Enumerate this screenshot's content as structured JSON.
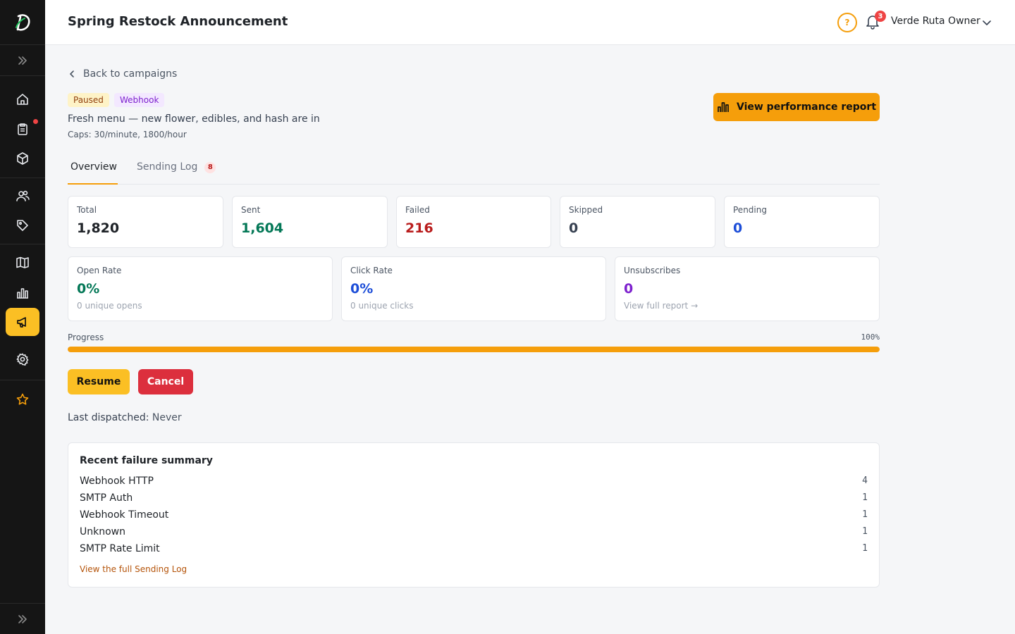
{
  "header": {
    "title": "Spring Restock Announcement",
    "help_icon": "?",
    "notification_count": "3",
    "user_name": "Verde Ruta Owner"
  },
  "sidebar": {
    "items": [
      {
        "name": "home",
        "icon": "home-icon"
      },
      {
        "name": "orders",
        "icon": "clipboard-icon",
        "has_dot": true
      },
      {
        "name": "products",
        "icon": "box-icon"
      },
      {
        "name": "customers",
        "icon": "users-icon"
      },
      {
        "name": "promotions",
        "icon": "tag-icon"
      },
      {
        "name": "menus",
        "icon": "book-icon"
      },
      {
        "name": "analytics",
        "icon": "bar-chart-icon"
      },
      {
        "name": "campaigns",
        "icon": "megaphone-icon",
        "active": true
      },
      {
        "name": "settings",
        "icon": "gear-icon"
      },
      {
        "name": "favorites",
        "icon": "star-icon"
      }
    ]
  },
  "campaign": {
    "back_label": "Back to campaigns",
    "status_badge": "Paused",
    "channel_badge": "Webhook",
    "subtitle": "Fresh menu — new flower, edibles, and hash are in",
    "caps": "Caps: 30/minute, 1800/hour",
    "perf_button": "View performance report"
  },
  "tabs": [
    {
      "label": "Overview",
      "active": true
    },
    {
      "label": "Sending Log",
      "count": "8"
    }
  ],
  "stats": [
    {
      "label": "Total",
      "value": "1,820",
      "color": "#1f2328"
    },
    {
      "label": "Sent",
      "value": "1,604",
      "color": "#047857"
    },
    {
      "label": "Failed",
      "value": "216",
      "color": "#b91c1c"
    },
    {
      "label": "Skipped",
      "value": "0",
      "color": "#374151"
    },
    {
      "label": "Pending",
      "value": "0",
      "color": "#1d4ed8"
    }
  ],
  "rates": [
    {
      "label": "Open Rate",
      "value": "0%",
      "sub": "0 unique opens",
      "color": "#047857"
    },
    {
      "label": "Click Rate",
      "value": "0%",
      "sub": "0 unique clicks",
      "color": "#1d4ed8"
    },
    {
      "label": "Unsubscribes",
      "value": "0",
      "sub": "View full report →",
      "color": "#7e22ce"
    }
  ],
  "progress": {
    "label": "Progress",
    "percent_label": "100%",
    "fraction": 1.0
  },
  "actions": {
    "resume": "Resume",
    "cancel": "Cancel"
  },
  "last_dispatched": {
    "key": "Last dispatched:",
    "value": "Never"
  },
  "failures": {
    "title": "Recent failure summary",
    "rows": [
      {
        "reason": "Webhook HTTP",
        "count": "4"
      },
      {
        "reason": "SMTP Auth",
        "count": "1"
      },
      {
        "reason": "Webhook Timeout",
        "count": "1"
      },
      {
        "reason": "Unknown",
        "count": "1"
      },
      {
        "reason": "SMTP Rate Limit",
        "count": "1"
      }
    ],
    "link": "View the full Sending Log"
  },
  "colors": {
    "accent": "#f59e0b",
    "sidebar_bg": "#151515",
    "danger": "#dc2f3d"
  }
}
